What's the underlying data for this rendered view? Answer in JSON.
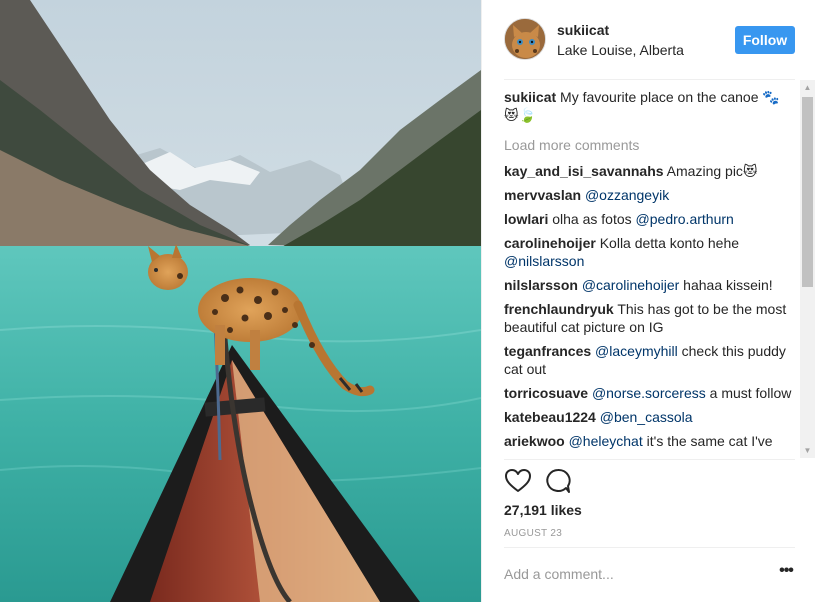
{
  "post": {
    "username": "sukiicat",
    "location": "Lake Louise, Alberta",
    "follow_label": "Follow",
    "caption_user": "sukiicat",
    "caption_text": "My favourite place on the canoe 🐾",
    "caption_emoji": "😻🍃",
    "load_more_label": "Load more comments",
    "likes": "27,191 likes",
    "date": "AUGUST 23",
    "add_comment_placeholder": "Add a comment...",
    "more_options_label": "•••"
  },
  "comments": [
    {
      "user": "kay_and_isi_savannahs",
      "text": "Amazing pic😻",
      "mention": "",
      "after": ""
    },
    {
      "user": "mervvaslan",
      "text": "",
      "mention": "@ozzangeyik",
      "after": ""
    },
    {
      "user": "lowlari",
      "text": "olha as fotos ",
      "mention": "@pedro.arthurn",
      "after": ""
    },
    {
      "user": "carolinehoijer",
      "text": "Kolla detta konto hehe ",
      "mention": "@nilslarsson",
      "after": ""
    },
    {
      "user": "nilslarsson",
      "text": "",
      "mention": "@carolinehoijer",
      "after": " hahaa kissein!"
    },
    {
      "user": "frenchlaundryuk",
      "text": "This has got to be the most beautiful cat picture on IG",
      "mention": "",
      "after": ""
    },
    {
      "user": "teganfrances",
      "text": "",
      "mention": "@laceymyhill",
      "after": " check this puddy cat out"
    },
    {
      "user": "torricosuave",
      "text": "",
      "mention": "@norse.sorceress",
      "after": " a must follow"
    },
    {
      "user": "katebeau1224",
      "text": "",
      "mention": "@ben_cassola",
      "after": ""
    },
    {
      "user": "ariekwoo",
      "text": "",
      "mention": "@heleychat",
      "after": " it's the same cat I've"
    }
  ],
  "icons": {
    "like": "heart-outline-icon",
    "comment": "speech-bubble-icon",
    "scroll_up": "▲",
    "scroll_down": "▼"
  },
  "colors": {
    "follow_bg": "#3897f0",
    "mention": "#003569",
    "muted": "#999999"
  }
}
